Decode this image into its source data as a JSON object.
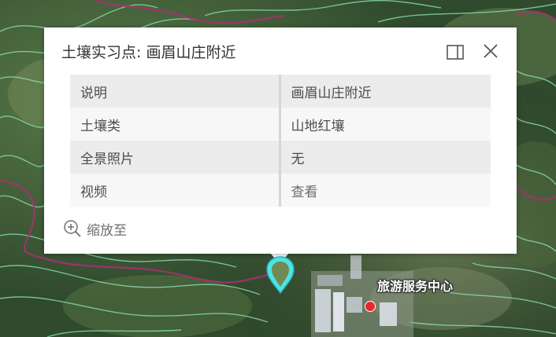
{
  "popup": {
    "title": "土壤实习点: 画眉山庄附近",
    "dock_icon": "dock-panel-icon",
    "close_icon": "close-icon",
    "attributes": [
      {
        "key": "说明",
        "value": "画眉山庄附近"
      },
      {
        "key": "土壤类",
        "value": "山地红壤"
      },
      {
        "key": "全景照片",
        "value": "无"
      },
      {
        "key": "视频",
        "value": "查看"
      }
    ],
    "zoom_to_label": "缩放至",
    "zoom_icon": "zoom-in-icon"
  },
  "map": {
    "poi_label": "旅游服务中心",
    "colors": {
      "contour": "#8ee6b8",
      "boundary": "#a3326e",
      "marker": "#4fe3e3",
      "poi_dot": "#e8262d"
    }
  }
}
